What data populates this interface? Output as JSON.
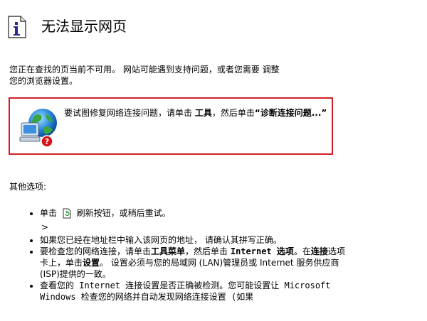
{
  "header": {
    "title": "无法显示网页"
  },
  "intro": {
    "line1": "您正在查找的页当前不可用。 网站可能遇到支持问题，或者您需要 调整",
    "line2": "您的浏览器设置。"
  },
  "diagnose": {
    "text_before": "要试图修复网络连接问题，请单击 ",
    "tools_label": "工具",
    "text_middle": "，然后单击",
    "link_label": "“诊断连接问题...”"
  },
  "other": {
    "title": "其他选项:"
  },
  "options": {
    "refresh_before": "单击",
    "refresh_after": "刷新按钮，或稍后重试。",
    "arrow": ">",
    "item2": "如果您已经在地址栏中输入该网页的地址， 请确认其拼写正确。",
    "item3_a": "要检查您的网络连接，请单击",
    "item3_tools_menu": "工具菜单",
    "item3_b": "，然后单击 ",
    "item3_internet_options": "Internet 选项",
    "item3_c": "。在",
    "item3_connections": "连接",
    "item3_d": "选项卡上，单击",
    "item3_settings": "设置",
    "item3_e": "。 设置必须与您的局域网 (LAN)管理员或 Internet 服务供应商(ISP)提供的一致。",
    "item4": "查看您的 Internet 连接设置是否正确被检测。您可能设置让 Microsoft Windows 检查您的网络并自动发现网络连接设置 (如果"
  },
  "icons": {
    "info": "info-document-icon",
    "globe": "network-globe-computer-icon",
    "help": "question-badge-icon",
    "refresh": "refresh-icon"
  },
  "colors": {
    "box_border": "#d21f24",
    "info_i": "#2e2a8a",
    "help_badge": "#d8141a"
  }
}
